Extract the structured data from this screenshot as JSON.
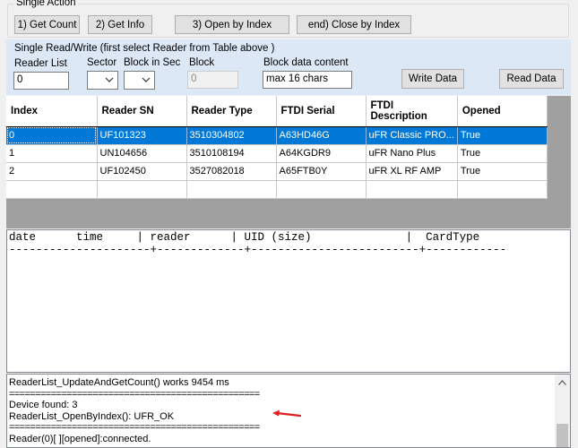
{
  "single_action": {
    "title": "Single Action",
    "buttons": {
      "get_count": "1) Get Count",
      "get_info": "2) Get Info",
      "open_by_index": "3) Open by Index",
      "close_by_index": "end) Close by Index"
    }
  },
  "read_write": {
    "title": "Single Read/Write  (first select Reader from Table above )",
    "reader_list_label": "Reader List",
    "reader_list_value": "0",
    "sector_label": "Sector",
    "block_in_sec_label": "Block in Sec",
    "block_label": "Block",
    "block_value": "0",
    "block_data_label": "Block data content",
    "block_data_value": "max 16 chars",
    "write_button": "Write Data",
    "read_button": "Read Data"
  },
  "grid": {
    "columns": [
      "Index",
      "Reader SN",
      "Reader Type",
      "FTDI Serial",
      "FTDI Description",
      "Opened"
    ],
    "rows": [
      [
        "0",
        "UF101323",
        "3510304802",
        "A63HD46G",
        "uFR Classic PRO...",
        "True"
      ],
      [
        "1",
        "UN104656",
        "3510108194",
        "A64KGDR9",
        "uFR Nano Plus",
        "True"
      ],
      [
        "2",
        "UF102450",
        "3527082018",
        "A65FTB0Y",
        "uFR XL RF AMP",
        "True"
      ],
      [
        "",
        "",
        "",
        "",
        "",
        ""
      ]
    ],
    "selected_row": 0
  },
  "card_log": {
    "header": "date      time     | reader      | UID (size)              |  CardType",
    "separator": "---------------------+-------------+-------------------------+------------"
  },
  "status_log": {
    "lines": [
      "ReaderList_UpdateAndGetCount() works 9454 ms",
      "================================================",
      "Device found: 3",
      "ReaderList_OpenByIndex(): UFR_OK",
      "================================================",
      "Reader(0)[ ][opened]:connected."
    ]
  },
  "colors": {
    "selection": "#0078d7",
    "arrow_annotation": "#e02020",
    "rw_panel_background": "#dce8f5"
  }
}
